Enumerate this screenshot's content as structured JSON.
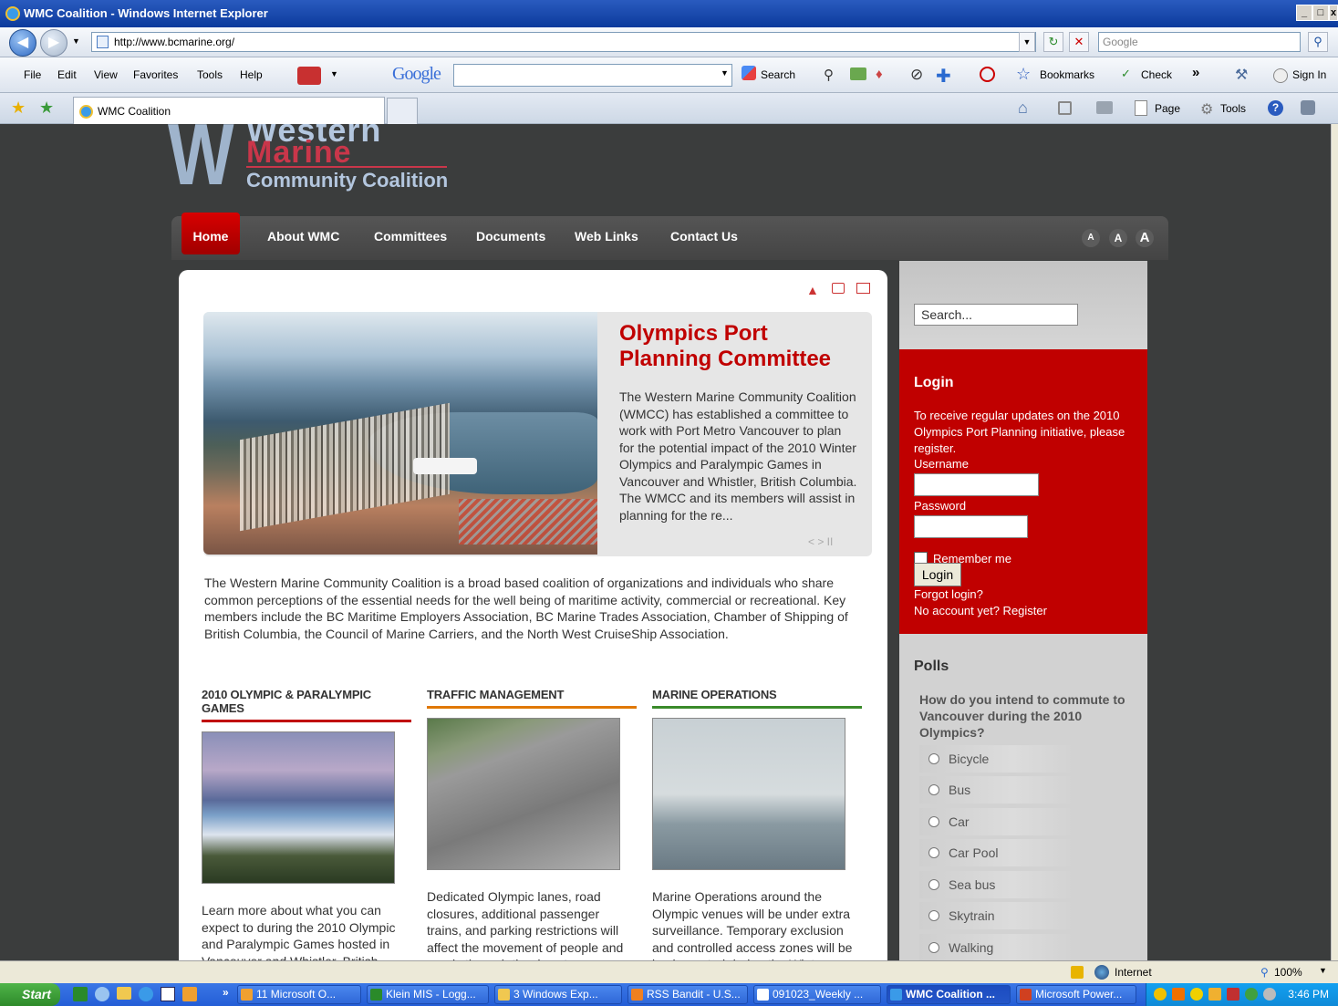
{
  "window": {
    "title": "WMC Coalition - Windows Internet Explorer",
    "min": "_",
    "max": "□",
    "close": "x"
  },
  "address": {
    "url": "http://www.bcmarine.org/",
    "search_placeholder": "Google"
  },
  "menu": [
    "File",
    "Edit",
    "View",
    "Favorites",
    "Tools",
    "Help"
  ],
  "google_toolbar": {
    "logo": "Google",
    "search": "Search",
    "bookmarks": "Bookmarks",
    "check": "Check",
    "more": "»",
    "sign_in": "Sign In"
  },
  "tab": {
    "title": "WMC Coalition"
  },
  "command_bar": {
    "page": "Page",
    "tools": "Tools"
  },
  "site": {
    "logo": {
      "line1": "Western",
      "line2": "Marine",
      "line3": "Community Coalition"
    },
    "nav": [
      "Home",
      "About WMC",
      "Committees",
      "Documents",
      "Web Links",
      "Contact Us"
    ],
    "font_sizes": [
      "A",
      "A",
      "A"
    ],
    "search_placeholder": "Search...",
    "feature": {
      "title": "Olympics Port Planning Committee",
      "text": "The Western Marine Community Coalition (WMCC) has established a committee to work with Port Metro Vancouver to plan for the potential impact of the 2010 Winter Olympics and Paralympic Games in Vancouver and Whistler, British Columbia.  The WMCC and its members will assist in planning for the re...",
      "controls": "< > II"
    },
    "intro": "The Western Marine Community Coalition is a broad based coalition of organizations and individuals who share common perceptions of the essential needs for the well being of maritime activity, commercial or recreational.  Key members include the BC Maritime Employers Association, BC Marine Trades Association, Chamber of Shipping of British Columbia, the Council of Marine Carriers, and the North West CruiseShip Association.",
    "columns": [
      {
        "heading": "2010 OLYMPIC & PARALYMPIC GAMES",
        "color": "#c00000",
        "text": "Learn more about what you can expect to during the 2010 Olympic and Paralympic Games hosted in Vancouver and Whistler, British Columbia during the months of"
      },
      {
        "heading": "TRAFFIC MANAGEMENT",
        "color": "#e07800",
        "text": "Dedicated Olympic lanes, road closures, additional passenger trains, and parking restrictions will affect the movement of people and goods through the downtown core"
      },
      {
        "heading": "MARINE OPERATIONS",
        "color": "#3a8a2a",
        "text": "Marine Operations around the Olympic venues will be under extra surveillance. Temporary exclusion and controlled access zones will be implemented during the Winter"
      }
    ],
    "login": {
      "title": "Login",
      "text": "To receive regular updates on the 2010 Olympics Port Planning initiative, please register.",
      "username_label": "Username",
      "password_label": "Password",
      "remember": "Remember me",
      "button": "Login",
      "forgot": "Forgot login?",
      "register": "No account yet? Register"
    },
    "polls": {
      "title": "Polls",
      "question": "How do you intend to commute to Vancouver during the 2010 Olympics?",
      "options": [
        "Bicycle",
        "Bus",
        "Car",
        "Car Pool",
        "Sea bus",
        "Skytrain",
        "Walking"
      ]
    }
  },
  "status": {
    "zone": "Internet",
    "zoom": "100%"
  },
  "taskbar": {
    "start": "Start",
    "tasks": [
      "11 Microsoft O...",
      "Klein MIS - Logg...",
      "3 Windows Exp...",
      "RSS Bandit - U.S...",
      "091023_Weekly ...",
      "WMC Coalition ...",
      "Microsoft Power..."
    ],
    "clock": "3:46 PM"
  }
}
